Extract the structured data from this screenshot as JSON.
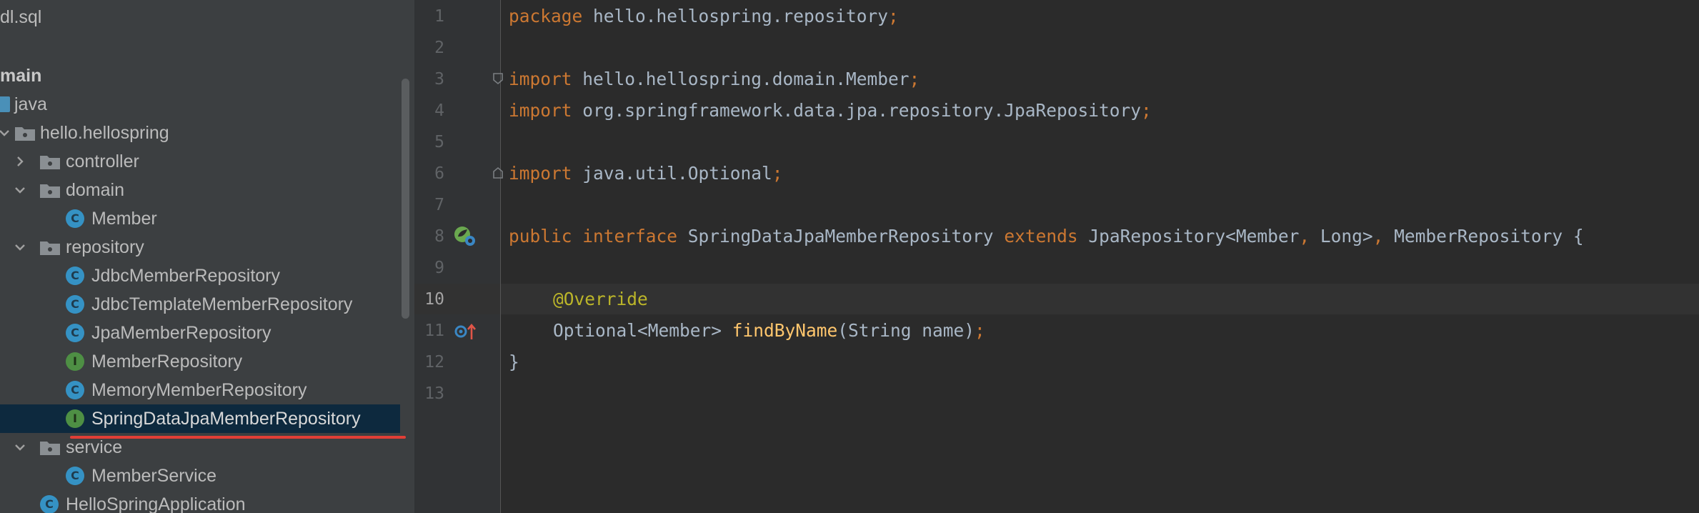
{
  "project_tree": {
    "items": [
      {
        "label": "dl.sql"
      },
      {
        "label": "main"
      },
      {
        "label": "java"
      },
      {
        "label": "hello.hellospring"
      },
      {
        "label": "controller"
      },
      {
        "label": "domain"
      },
      {
        "label": "Member",
        "kind": "class"
      },
      {
        "label": "repository"
      },
      {
        "label": "JdbcMemberRepository",
        "kind": "class"
      },
      {
        "label": "JdbcTemplateMemberRepository",
        "kind": "class"
      },
      {
        "label": "JpaMemberRepository",
        "kind": "class"
      },
      {
        "label": "MemberRepository",
        "kind": "interface"
      },
      {
        "label": "MemoryMemberRepository",
        "kind": "class"
      },
      {
        "label": "SpringDataJpaMemberRepository",
        "kind": "interface",
        "selected": true
      },
      {
        "label": "service"
      },
      {
        "label": "MemberService",
        "kind": "class"
      },
      {
        "label": "HelloSpringApplication",
        "kind": "spring-boot-class"
      }
    ],
    "badge_class": "C",
    "badge_interface": "I"
  },
  "editor": {
    "current_line": 10,
    "line_numbers": [
      "1",
      "2",
      "3",
      "4",
      "5",
      "6",
      "7",
      "8",
      "9",
      "10",
      "11",
      "12",
      "13"
    ],
    "code": {
      "l1_kw": "package",
      "l1_rest": " hello.hellospring.repository",
      "l3_kw": "import",
      "l3_rest": " hello.hellospring.domain.Member",
      "l4_kw": "import",
      "l4_rest": " org.springframework.data.jpa.repository.JpaRepository",
      "l6_kw": "import",
      "l6_rest": " java.util.Optional",
      "l8_kw1": "public",
      "l8_kw2": "interface",
      "l8_name": " SpringDataJpaMemberRepository ",
      "l8_kw3": "extends",
      "l8_type": " JpaRepository<Member",
      "l8_type2": " Long>",
      "l8_tail": " MemberRepository {",
      "l10_ann": "@Override",
      "l11_type": "Optional<Member> ",
      "l11_fn": "findByName",
      "l11_args": "(String name)",
      "l12": "}",
      "semicolon": ";",
      "comma": ","
    }
  },
  "colors": {
    "keyword": "#cc7832",
    "annotation": "#bbb529",
    "method": "#ffc66d",
    "text": "#a9b7c6",
    "selection_underline": "#e03e36"
  }
}
